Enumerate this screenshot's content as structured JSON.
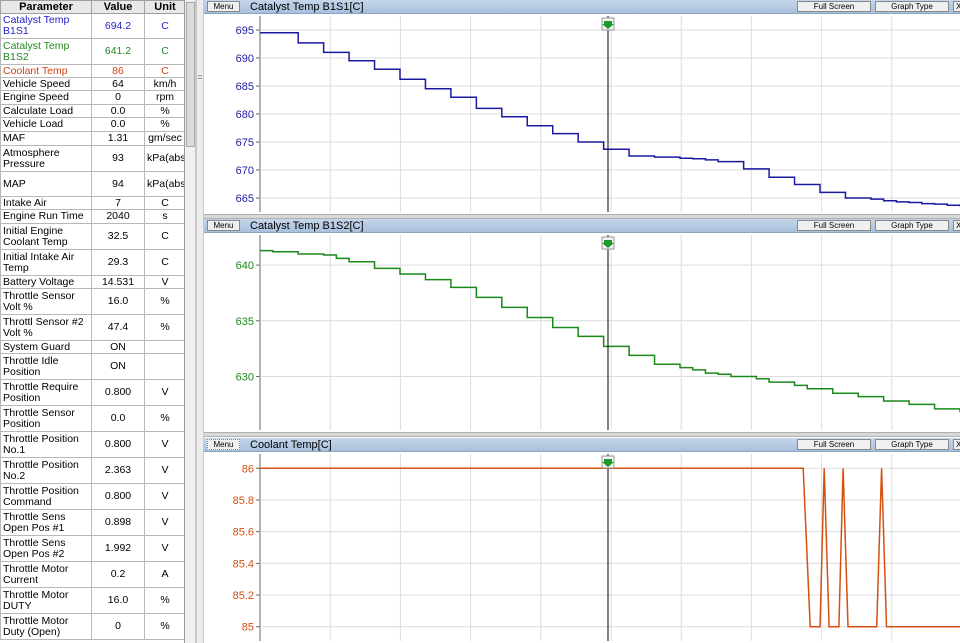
{
  "table": {
    "headers": {
      "parameter": "Parameter",
      "value": "Value",
      "unit": "Unit"
    },
    "rows": [
      {
        "name": "Catalyst Temp B1S1",
        "value": "694.2",
        "unit": "C",
        "color": "#2222cc",
        "h": 25
      },
      {
        "name": "Catalyst Temp B1S2",
        "value": "641.2",
        "unit": "C",
        "color": "#228822",
        "h": 26
      },
      {
        "name": "Coolant Temp",
        "value": "86",
        "unit": "C",
        "color": "#cc4411",
        "h": 13
      },
      {
        "name": "Vehicle Speed",
        "value": "64",
        "unit": "km/h",
        "h": 13
      },
      {
        "name": "Engine Speed",
        "value": "0",
        "unit": "rpm",
        "h": 14
      },
      {
        "name": "Calculate Load",
        "value": "0.0",
        "unit": "%",
        "h": 13
      },
      {
        "name": "Vehicle Load",
        "value": "0.0",
        "unit": "%",
        "h": 14
      },
      {
        "name": "MAF",
        "value": "1.31",
        "unit": "gm/sec",
        "h": 14
      },
      {
        "name": "Atmosphere Pressure",
        "value": "93",
        "unit": "kPa(abs)",
        "h": 26
      },
      {
        "name": "MAP",
        "value": "94",
        "unit": "kPa(abs)",
        "h": 25
      },
      {
        "name": "Intake Air",
        "value": "7",
        "unit": "C",
        "h": 13
      },
      {
        "name": "Engine Run Time",
        "value": "2040",
        "unit": "s",
        "h": 14
      },
      {
        "name": "Initial Engine Coolant Temp",
        "value": "32.5",
        "unit": "C",
        "h": 26
      },
      {
        "name": "Initial Intake Air Temp",
        "value": "29.3",
        "unit": "C",
        "h": 26
      },
      {
        "name": "Battery Voltage",
        "value": "14.531",
        "unit": "V",
        "h": 13
      },
      {
        "name": "Throttle Sensor Volt %",
        "value": "16.0",
        "unit": "%",
        "h": 26
      },
      {
        "name": "Throttl Sensor #2 Volt %",
        "value": "47.4",
        "unit": "%",
        "h": 26
      },
      {
        "name": "System Guard",
        "value": "ON",
        "unit": "",
        "h": 13
      },
      {
        "name": "Throttle Idle Position",
        "value": "ON",
        "unit": "",
        "h": 26
      },
      {
        "name": "Throttle Require Position",
        "value": "0.800",
        "unit": "V",
        "h": 26
      },
      {
        "name": "Throttle Sensor Position",
        "value": "0.0",
        "unit": "%",
        "h": 26
      },
      {
        "name": "Throttle Position No.1",
        "value": "0.800",
        "unit": "V",
        "h": 26
      },
      {
        "name": "Throttle Position No.2",
        "value": "2.363",
        "unit": "V",
        "h": 26
      },
      {
        "name": "Throttle Position Command",
        "value": "0.800",
        "unit": "V",
        "h": 26
      },
      {
        "name": "Throttle Sens Open Pos #1",
        "value": "0.898",
        "unit": "V",
        "h": 26
      },
      {
        "name": "Throttle Sens Open Pos #2",
        "value": "1.992",
        "unit": "V",
        "h": 26
      },
      {
        "name": "Throttle Motor Current",
        "value": "0.2",
        "unit": "A",
        "h": 26
      },
      {
        "name": "Throttle Motor DUTY",
        "value": "16.0",
        "unit": "%",
        "h": 26
      },
      {
        "name": "Throttle Motor Duty (Open)",
        "value": "0",
        "unit": "%",
        "h": 26
      }
    ]
  },
  "graphs": [
    {
      "title": "Catalyst Temp B1S1[C]",
      "menu_label": "Menu",
      "fullscreen_label": "Full Screen",
      "graphtype_label": "Graph Type",
      "close_label": "X",
      "color": "#1a1aa0",
      "ymin": 662.5,
      "ymax": 697.5,
      "yticks": [
        695,
        690,
        685,
        680,
        675,
        670,
        665
      ],
      "ytick_labels": [
        "695",
        "690",
        "685",
        "680",
        "675",
        "670",
        "665"
      ],
      "series": [
        694.5,
        694.5,
        694.5,
        692.7,
        692.7,
        691.0,
        691.0,
        689.5,
        689.5,
        688.0,
        688.0,
        686.2,
        686.2,
        684.5,
        684.5,
        683.0,
        683.0,
        681.0,
        681.0,
        679.5,
        679.5,
        677.9,
        677.9,
        676.5,
        676.5,
        675.0,
        675.0,
        673.7,
        673.7,
        672.5,
        672.5,
        672.3,
        672.3,
        672.1,
        672.0,
        671.8,
        671.5,
        671.5,
        670.2,
        670.2,
        668.7,
        668.7,
        667.4,
        667.4,
        666.0,
        666.0,
        665.0,
        665.0,
        664.8,
        664.5,
        664.3,
        664.2,
        664.0,
        663.9,
        663.7,
        663.5
      ]
    },
    {
      "title": "Catalyst Temp B1S2[C]",
      "menu_label": "Menu",
      "fullscreen_label": "Full Screen",
      "graphtype_label": "Graph Type",
      "close_label": "X",
      "color": "#1a8a1a",
      "ymin": 625.2,
      "ymax": 642.7,
      "yticks": [
        640,
        635,
        630
      ],
      "ytick_labels": [
        "640",
        "635",
        "630"
      ],
      "series": [
        641.3,
        641.2,
        641.2,
        641.0,
        641.0,
        640.9,
        640.6,
        640.3,
        640.3,
        639.7,
        639.7,
        639.2,
        639.2,
        638.7,
        638.7,
        638.0,
        638.0,
        637.1,
        637.1,
        636.2,
        636.2,
        635.3,
        635.3,
        634.4,
        634.4,
        633.6,
        633.6,
        632.7,
        632.7,
        631.9,
        631.9,
        631.1,
        631.1,
        630.8,
        630.6,
        630.3,
        630.2,
        630.0,
        630.0,
        629.8,
        629.5,
        629.5,
        629.2,
        628.9,
        628.9,
        628.5,
        628.5,
        628.2,
        628.2,
        627.8,
        627.8,
        627.5,
        627.5,
        627.1,
        627.1,
        626.8
      ]
    },
    {
      "title": "Coolant Temp[C]",
      "menu_label": "Menu",
      "fullscreen_label": "Full Screen",
      "graphtype_label": "Graph Type",
      "close_label": "X",
      "color": "#d45010",
      "ymin": 84.91,
      "ymax": 86.09,
      "yticks": [
        86,
        85.8,
        85.6,
        85.4,
        85.2,
        85
      ],
      "ytick_labels": [
        "86",
        "85.8",
        "85.6",
        "85.4",
        "85.2",
        "85"
      ],
      "series_points": [
        [
          0,
          86
        ],
        [
          0.776,
          86
        ],
        [
          0.786,
          85
        ],
        [
          0.8,
          85
        ],
        [
          0.806,
          86
        ],
        [
          0.813,
          85
        ],
        [
          0.827,
          85
        ],
        [
          0.833,
          86
        ],
        [
          0.84,
          85
        ],
        [
          0.881,
          85
        ],
        [
          0.888,
          86
        ],
        [
          0.895,
          85
        ],
        [
          1,
          85
        ]
      ]
    }
  ]
}
